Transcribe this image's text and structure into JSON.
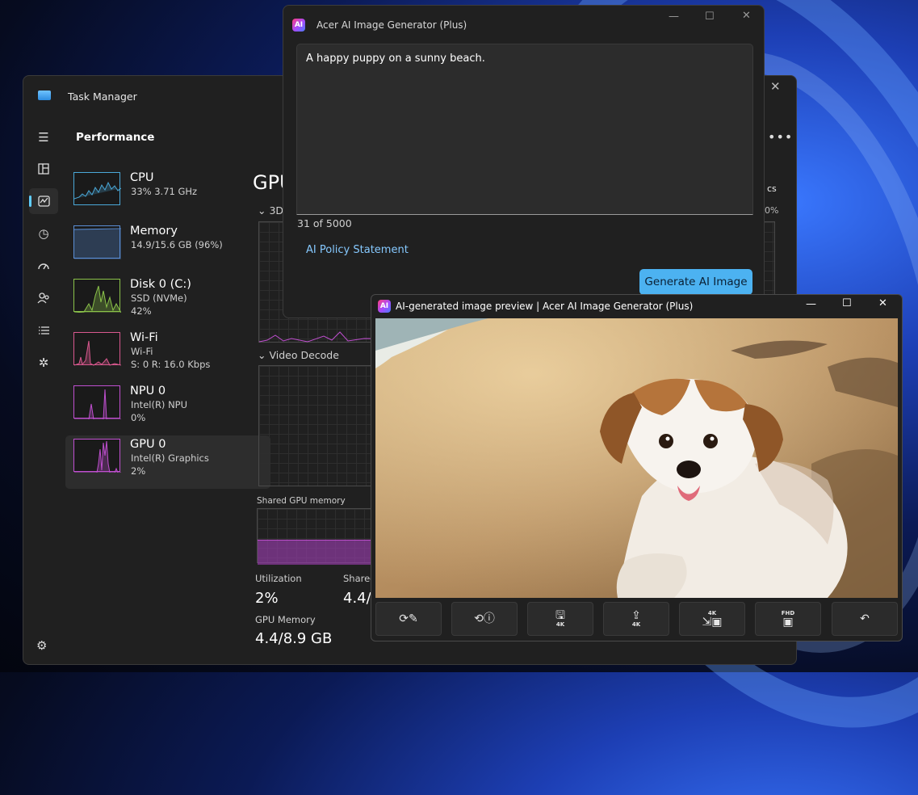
{
  "task_manager": {
    "title": "Task Manager",
    "section": "Performance",
    "more_icon": "ellipsis-icon",
    "nav": [
      "hamburger-icon",
      "processes-icon",
      "performance-icon",
      "app-history-icon",
      "startup-icon",
      "users-icon",
      "details-icon",
      "services-icon",
      "settings-icon"
    ],
    "items": [
      {
        "name": "CPU",
        "sub1": "33% 3.71 GHz",
        "sub2": "",
        "color": "#4aa8d8"
      },
      {
        "name": "Memory",
        "sub1": "14.9/15.6 GB (96%)",
        "sub2": "",
        "color": "#5b8fd6"
      },
      {
        "name": "Disk 0 (C:)",
        "sub1": "SSD (NVMe)",
        "sub2": "42%",
        "color": "#8bc34a"
      },
      {
        "name": "Wi-Fi",
        "sub1": "Wi-Fi",
        "sub2": "S: 0 R: 16.0 Kbps",
        "color": "#d9588f"
      },
      {
        "name": "NPU 0",
        "sub1": "Intel(R) NPU",
        "sub2": "0%",
        "color": "#c04fd0"
      },
      {
        "name": "GPU 0",
        "sub1": "Intel(R) Graphics",
        "sub2": "2%",
        "color": "#c04fd0"
      }
    ],
    "gpu_heading": "GPU",
    "engine_3d": "3D",
    "video_decode": "Video Decode",
    "shared_gpu_memory": "Shared GPU memory",
    "rcs_label": "cs",
    "rcs_pct": "0%",
    "stats": {
      "utilization_label": "Utilization",
      "utilization_value": "2%",
      "shared_label": "Shared",
      "shared_value": "4.4/",
      "gpu_memory_label": "GPU Memory",
      "gpu_memory_value": "4.4/8.9 GB"
    }
  },
  "acer_window": {
    "title": "Acer AI Image Generator (Plus)",
    "logo_text": "AI",
    "prompt": "A happy puppy on a sunny beach.",
    "counter": "31 of 5000",
    "policy_link": "AI Policy Statement",
    "generate_button": "Generate AI Image"
  },
  "preview_window": {
    "title": "AI-generated image preview | Acer AI Image Generator (Plus)",
    "logo_text": "AI",
    "image_subject": "puppy on beach",
    "toolbar": [
      {
        "icon": "regenerate-edit-icon",
        "badge": ""
      },
      {
        "icon": "rerun-info-icon",
        "badge": ""
      },
      {
        "icon": "save-icon",
        "badge": "4K"
      },
      {
        "icon": "share-icon",
        "badge": "4K"
      },
      {
        "icon": "set-wallpaper-icon",
        "badge": "4K"
      },
      {
        "icon": "fhd-image-icon",
        "badge": "FHD"
      },
      {
        "icon": "undo-icon",
        "badge": ""
      }
    ]
  }
}
